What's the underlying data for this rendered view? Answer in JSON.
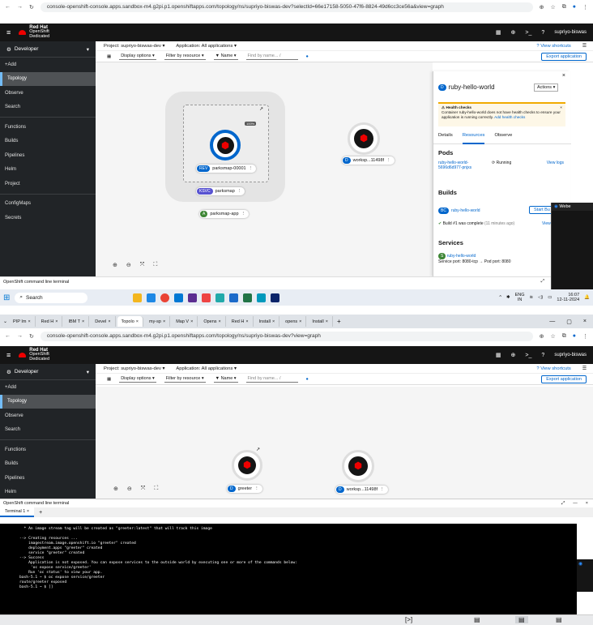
{
  "top": {
    "url": "console-openshift-console.apps.sandbox-m4.g2pi.p1.openshiftapps.com/topology/ns/supriyo-biswas-dev?selectId=66e17158-5050-47f6-8824-49d6cc3ce56a&view=graph",
    "brand": {
      "line1": "Red Hat",
      "line2": "OpenShift",
      "line3": "Dedicated"
    },
    "user": "supriyo-biswas",
    "perspective": "Developer",
    "nav": [
      "+Add",
      "Topology",
      "Observe",
      "Search",
      "Functions",
      "Builds",
      "Pipelines",
      "Helm",
      "Project",
      "ConfigMaps",
      "Secrets"
    ],
    "project": "Project: supriyo-biswas-dev",
    "application": "Application: All applications",
    "view_shortcuts": "View shortcuts",
    "toolbar": {
      "display": "Display options",
      "filter": "Filter by resource",
      "name": "Name",
      "find_placeholder": "Find by name...",
      "slash": "/",
      "export": "Export application"
    },
    "nodes": {
      "rev": "REV",
      "rev_name": "parksmap-00001",
      "ksvc": "KSVC",
      "ksvc_name": "parksmap",
      "app": "A",
      "app_name": "parksmap-app",
      "d": "D",
      "worksp": "worksp...11498f",
      "traffic": "100%"
    },
    "panel": {
      "title": "ruby-hello-world",
      "badge": "D",
      "actions": "Actions",
      "health_title": "Health checks",
      "health_text": "Container ruby-hello-world does not have health checks to ensure your application is running correctly.",
      "health_link": "Add health checks",
      "tabs": [
        "Details",
        "Resources",
        "Observe"
      ],
      "pods_h": "Pods",
      "pod_name": "ruby-hello-world-5696d6d977-pnjxs",
      "pod_status": "Running",
      "view_logs": "View logs",
      "builds_h": "Builds",
      "bc": "BC",
      "build_cfg": "ruby-hello-world",
      "start_build": "Start Bu",
      "build_status": "Build #1 was complete",
      "build_time": "(11 minutes ago)",
      "view": "View",
      "services_h": "Services",
      "svc": "ruby-hello-world",
      "svc_port": "Service port: 8080-tcp → Pod port: 8080"
    },
    "cmd_label": "OpenShift command line terminal",
    "taskbar": {
      "search": "Search",
      "lang1": "ENG",
      "lang2": "IN",
      "time": "16:07",
      "date": "12-11-2024"
    },
    "webex": "Webe"
  },
  "bottom": {
    "tabs": [
      "PIP Im",
      "Red H",
      "IBM T",
      "Devel",
      "Topolo",
      "my-sp",
      "Map V",
      "Opens",
      "Red H",
      "Install",
      "opens",
      "Install"
    ],
    "url": "console-openshift-console.apps.sandbox-m4.g2pi.p1.openshiftapps.com/topology/ns/supriyo-biswas-dev?view=graph",
    "greeter": "greeter",
    "worksp": "worksp...11498f",
    "cmd_label": "OpenShift command line terminal",
    "term_tab": "Terminal 1",
    "term_lines": [
      "  * An image stream tag will be created as \"greeter:latest\" that will track this image",
      "",
      "--> Creating resources ...",
      "    imagestream.image.openshift.io \"greeter\" created",
      "    deployment.apps \"greeter\" created",
      "    service \"greeter\" created",
      "--> Success",
      "    Application is not exposed. You can expose services to the outside world by executing one or more of the commands below:",
      "     'oc expose service/greeter'",
      "    Run 'oc status' to view your app.",
      "bash-5.1 ~ $ oc expose service/greeter",
      "route/greeter exposed",
      "bash-5.1 ~ $ []"
    ]
  }
}
